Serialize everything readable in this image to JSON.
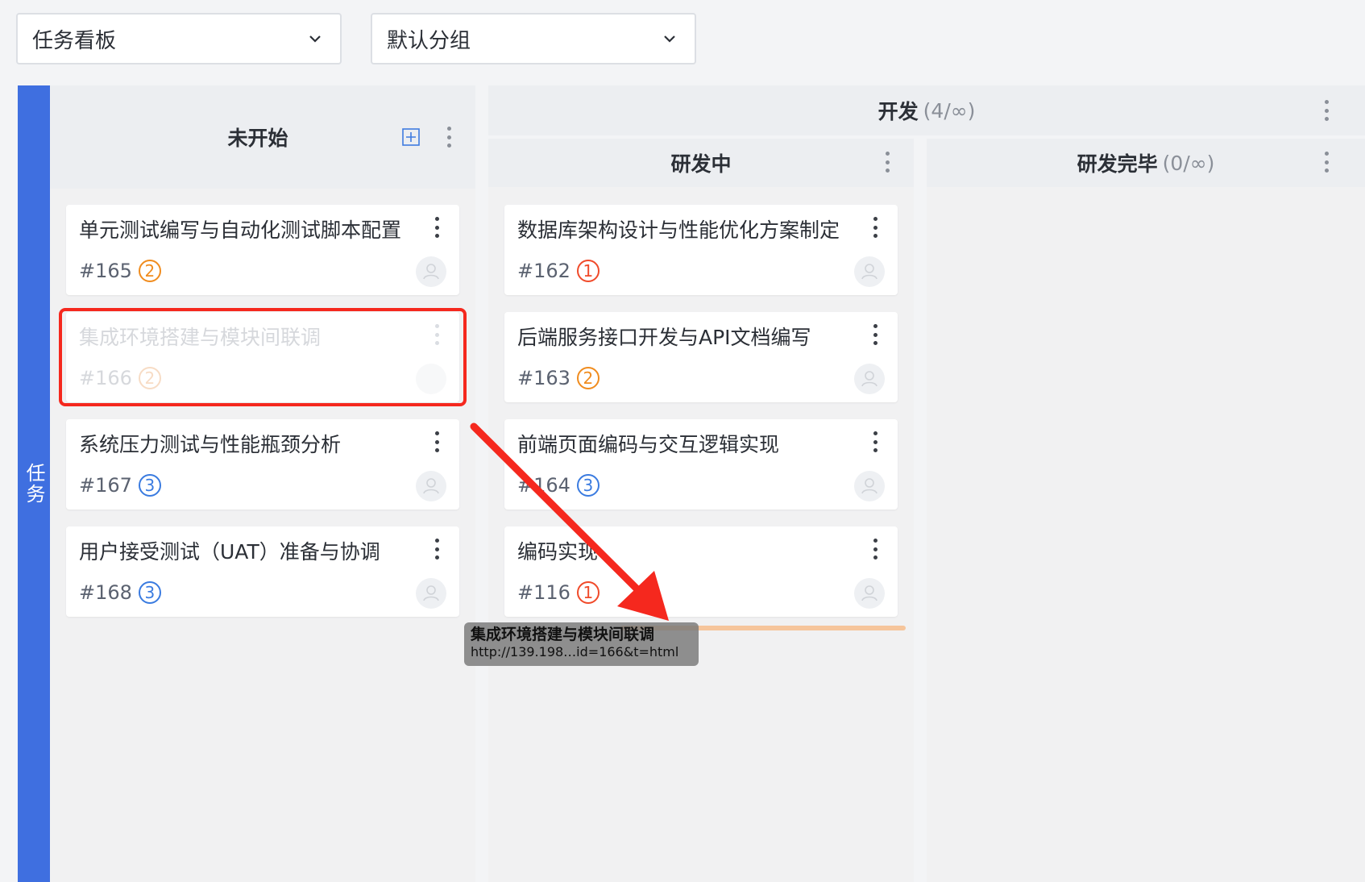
{
  "filters": {
    "board": {
      "value": "任务看板",
      "icon": "chevron-down-icon"
    },
    "group": {
      "value": "默认分组",
      "icon": "chevron-down-icon"
    }
  },
  "swimlane": {
    "label": "任务",
    "color": "#3f6fe0"
  },
  "columns": {
    "not_started": {
      "title": "未开始",
      "add_icon": "plus-square-icon"
    },
    "dev_group": {
      "title": "开发",
      "count": "(4/∞)"
    },
    "in_dev": {
      "title": "研发中"
    },
    "dev_done": {
      "title": "研发完毕",
      "count": "(0/∞)"
    }
  },
  "cards_not_started": [
    {
      "title": "单元测试编写与自动化测试脚本配置",
      "id": "#165",
      "priority": "2"
    },
    {
      "title": "集成环境搭建与模块间联调",
      "id": "#166",
      "priority": "2",
      "state": "dragging"
    },
    {
      "title": "系统压力测试与性能瓶颈分析",
      "id": "#167",
      "priority": "3"
    },
    {
      "title": "用户接受测试（UAT）准备与协调",
      "id": "#168",
      "priority": "3"
    }
  ],
  "cards_in_dev": [
    {
      "title": "数据库架构设计与性能优化方案制定",
      "id": "#162",
      "priority": "1"
    },
    {
      "title": "后端服务接口开发与API文档编写",
      "id": "#163",
      "priority": "2"
    },
    {
      "title": "前端页面编码与交互逻辑实现",
      "id": "#164",
      "priority": "3"
    },
    {
      "title": "编码实现",
      "id": "#116",
      "priority": "1"
    }
  ],
  "priority_colors": {
    "1": "#f04a2a",
    "2": "#f08c1e",
    "3": "#3a7be0"
  },
  "drag_tooltip": {
    "title": "集成环境搭建与模块间联调",
    "url": "http://139.198…id=166&t=html"
  },
  "annotation": {
    "color": "#f5281e"
  }
}
